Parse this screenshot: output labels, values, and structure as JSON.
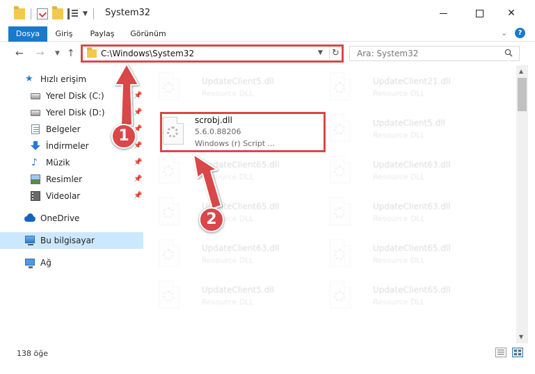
{
  "window": {
    "title": "System32",
    "minimize_glyph": "",
    "close_glyph": "✕"
  },
  "ribbon": {
    "tabs": [
      {
        "label": "Dosya",
        "active": true
      },
      {
        "label": "Giriş"
      },
      {
        "label": "Paylaş"
      },
      {
        "label": "Görünüm"
      }
    ],
    "help_glyph": "?"
  },
  "nav": {
    "back_glyph": "←",
    "forward_glyph": "→",
    "up_glyph": "↑",
    "address": "C:\\Windows\\System32",
    "refresh_glyph": "↻",
    "search_placeholder": "Ara: System32"
  },
  "sidebar": {
    "items": [
      {
        "label": "Hızlı erişim",
        "icon": "star-icon"
      },
      {
        "label": "Yerel Disk (C:)",
        "icon": "disk-icon",
        "pinned": true
      },
      {
        "label": "Yerel Disk (D:)",
        "icon": "disk-icon",
        "pinned": true
      },
      {
        "label": "Belgeler",
        "icon": "documents-icon",
        "pinned": true
      },
      {
        "label": "İndirmeler",
        "icon": "downloads-icon",
        "pinned": true
      },
      {
        "label": "Müzik",
        "icon": "music-icon",
        "pinned": true
      },
      {
        "label": "Resimler",
        "icon": "pictures-icon",
        "pinned": true
      },
      {
        "label": "Videolar",
        "icon": "videos-icon",
        "pinned": true
      },
      {
        "label": "OneDrive",
        "icon": "cloud-icon"
      },
      {
        "label": "Bu bilgisayar",
        "icon": "computer-icon",
        "selected": true
      },
      {
        "label": "Ağ",
        "icon": "network-icon"
      }
    ]
  },
  "files": {
    "left": [
      {
        "name": "UpdateClient5.dll",
        "desc": "Resource DLL"
      },
      {
        "name": "scrobj.dll",
        "version": "5.6.0.88206",
        "desc": "Windows (r) Script ...",
        "highlighted": true
      },
      {
        "name": "UpdateClient65.dll",
        "desc": "Resource DLL"
      },
      {
        "name": "UpdateClient65.dll",
        "desc": "Resource DLL"
      },
      {
        "name": "UpdateClient63.dll",
        "desc": "Resource DLL"
      },
      {
        "name": "UpdateClient5.dll",
        "desc": "Resource DLL"
      }
    ],
    "right": [
      {
        "name": "UpdateClient21.dll",
        "desc": "Resource DLL"
      },
      {
        "name": "UpdateClient5.dll",
        "desc": "Resource DLL"
      },
      {
        "name": "UpdateClient63.dll",
        "desc": "Resource DLL"
      },
      {
        "name": "UpdateClient63.dll",
        "desc": "Resource DLL"
      },
      {
        "name": "UpdateClient65.dll",
        "desc": "Resource DLL"
      },
      {
        "name": "UpdateClient65.dll",
        "desc": "Resource DLL"
      }
    ]
  },
  "status": {
    "item_count": "138 öğe"
  },
  "annotations": {
    "step1": "1",
    "step2": "2",
    "color": "#d9474a"
  }
}
